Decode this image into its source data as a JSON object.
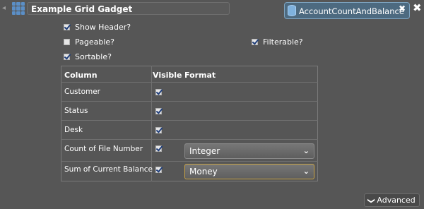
{
  "gadget": {
    "collapse_glyph": "◂",
    "title": "Example Grid Gadget",
    "datasource": "AccountCountAndBalance",
    "close_glyph": "✖",
    "tab_close_glyph": "✖"
  },
  "options": {
    "show_header": {
      "label": "Show Header?",
      "checked": true
    },
    "pageable": {
      "label": "Pageable?",
      "checked": false
    },
    "sortable": {
      "label": "Sortable?",
      "checked": true
    },
    "filterable": {
      "label": "Filterable?",
      "checked": true
    }
  },
  "columns_table": {
    "headers": {
      "column": "Column",
      "visible": "Visible",
      "format": "Format"
    },
    "rows": [
      {
        "column": "Customer",
        "visible": true,
        "format": ""
      },
      {
        "column": "Status",
        "visible": true,
        "format": ""
      },
      {
        "column": "Desk",
        "visible": true,
        "format": ""
      },
      {
        "column": "Count of File Number",
        "visible": true,
        "format": "Integer"
      },
      {
        "column": "Sum of Current Balance",
        "visible": true,
        "format": "Money"
      }
    ]
  },
  "advanced_button": {
    "label": "Advanced",
    "icon": "chevron-down-icon"
  },
  "colors": {
    "background": "#565656",
    "tab_blue": "#4d6a80",
    "focus_border": "#c8a346"
  }
}
